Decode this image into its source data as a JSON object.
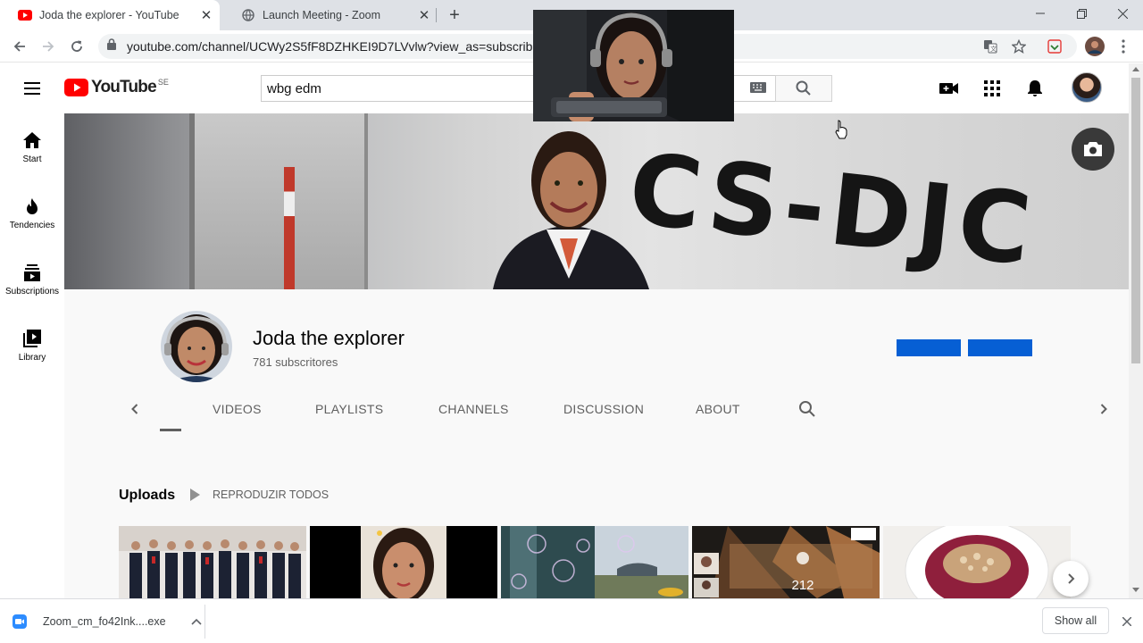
{
  "browser": {
    "tabs": [
      {
        "title": "Joda the explorer - YouTube",
        "favicon": "youtube-icon",
        "active": true
      },
      {
        "title": "Launch Meeting - Zoom",
        "favicon": "globe-icon",
        "active": false
      }
    ],
    "url": "youtube.com/channel/UCWy2S5fF8DZHKEI9D7LVvlw?view_as=subscriber"
  },
  "masthead": {
    "logo_text": "YouTube",
    "country_code": "SE",
    "search_value": "wbg edm"
  },
  "guide": {
    "items": [
      {
        "label": "Start",
        "icon": "home-icon"
      },
      {
        "label": "Tendencies",
        "icon": "trending-icon"
      },
      {
        "label": "Subscriptions",
        "icon": "subscriptions-icon"
      },
      {
        "label": "Library",
        "icon": "library-icon"
      }
    ]
  },
  "banner": {
    "registration_text": "CS-DJC"
  },
  "channel": {
    "name": "Joda the explorer",
    "subscribers": "781 subscritores",
    "tabs": [
      "VIDEOS",
      "PLAYLISTS",
      "CHANNELS",
      "DISCUSSION",
      "ABOUT"
    ]
  },
  "shelf": {
    "title": "Uploads",
    "play_all": "REPRODUZIR TODOS",
    "thumb4_number": "212"
  },
  "download": {
    "filename": "Zoom_cm_fo42Ink....exe",
    "show_all": "Show all"
  },
  "colors": {
    "youtube_red": "#ff0000",
    "button_blue": "#065fd4",
    "zoom_blue": "#2d8cff"
  }
}
